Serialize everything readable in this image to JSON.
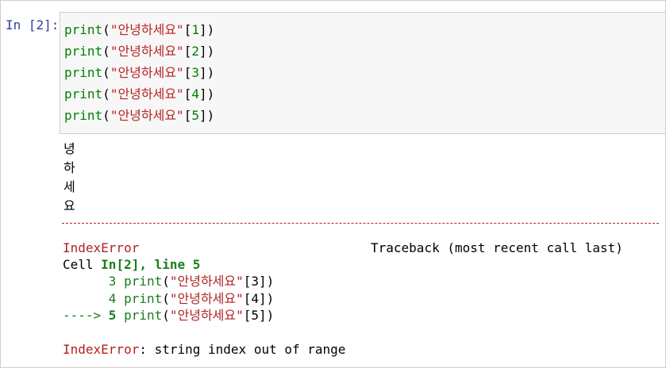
{
  "cell": {
    "prompt": "In [2]:",
    "code_lines": [
      {
        "func": "print",
        "open": "(",
        "string": "\"안녕하세요\"",
        "bracket_open": "[",
        "index": "1",
        "close": "])"
      },
      {
        "func": "print",
        "open": "(",
        "string": "\"안녕하세요\"",
        "bracket_open": "[",
        "index": "2",
        "close": "])"
      },
      {
        "func": "print",
        "open": "(",
        "string": "\"안녕하세요\"",
        "bracket_open": "[",
        "index": "3",
        "close": "])"
      },
      {
        "func": "print",
        "open": "(",
        "string": "\"안녕하세요\"",
        "bracket_open": "[",
        "index": "4",
        "close": "])"
      },
      {
        "func": "print",
        "open": "(",
        "string": "\"안녕하세요\"",
        "bracket_open": "[",
        "index": "5",
        "close": "])"
      }
    ]
  },
  "output": {
    "stdout_lines": [
      "녕",
      "하",
      "세",
      "요"
    ],
    "traceback": {
      "error_name": "IndexError",
      "header_right": "Traceback (most recent call last)",
      "cell_prefix": "Cell ",
      "cell_ref": "In[2], line 5",
      "context": [
        {
          "marker": "      ",
          "lineno": "3",
          "func": "print",
          "open": "(",
          "string": "\"안녕하세요\"",
          "rest": "[3])"
        },
        {
          "marker": "      ",
          "lineno": "4",
          "func": "print",
          "open": "(",
          "string": "\"안녕하세요\"",
          "rest": "[4])"
        },
        {
          "marker": "----> ",
          "lineno": "5",
          "func": "print",
          "open": "(",
          "string": "\"안녕하세요\"",
          "rest": "[5])"
        }
      ],
      "final_error_name": "IndexError",
      "final_message": ": string index out of range"
    }
  },
  "colors": {
    "prompt": "#303f9f",
    "keyword": "#008000",
    "string": "#ba2121",
    "error": "#b22222",
    "input_bg": "#f7f7f7"
  }
}
